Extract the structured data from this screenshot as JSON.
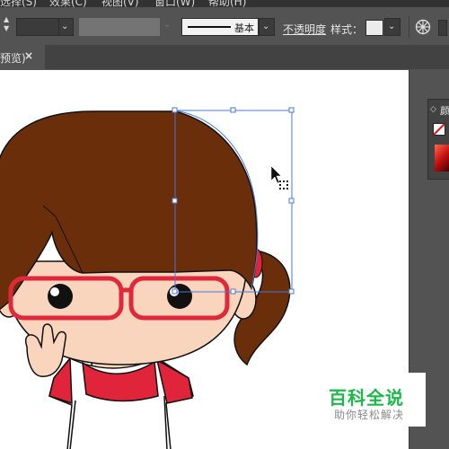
{
  "menubar": {
    "items": [
      {
        "label": "选择(S)"
      },
      {
        "label": "效果(C)"
      },
      {
        "label": "视图(V)"
      },
      {
        "label": "窗口(W)"
      },
      {
        "label": "帮助(H)"
      }
    ]
  },
  "control_bar": {
    "stroke_profile_label": "基本",
    "opacity_label": "不透明度",
    "style_label": "样式："
  },
  "document_tab": {
    "title_fragment": "预览)",
    "close_label": "×"
  },
  "right_panel": {
    "panel_title_fragment": "颜"
  },
  "watermark": {
    "title": "百科全说",
    "subtitle": "助你轻松解决"
  },
  "colors": {
    "hair": "#6b2e0a",
    "skin": "#f9d5bd",
    "glasses": "#e0283a",
    "shirt": "#e0253a",
    "selection": "#4a78d6",
    "watermark_green": "#1db84a"
  }
}
